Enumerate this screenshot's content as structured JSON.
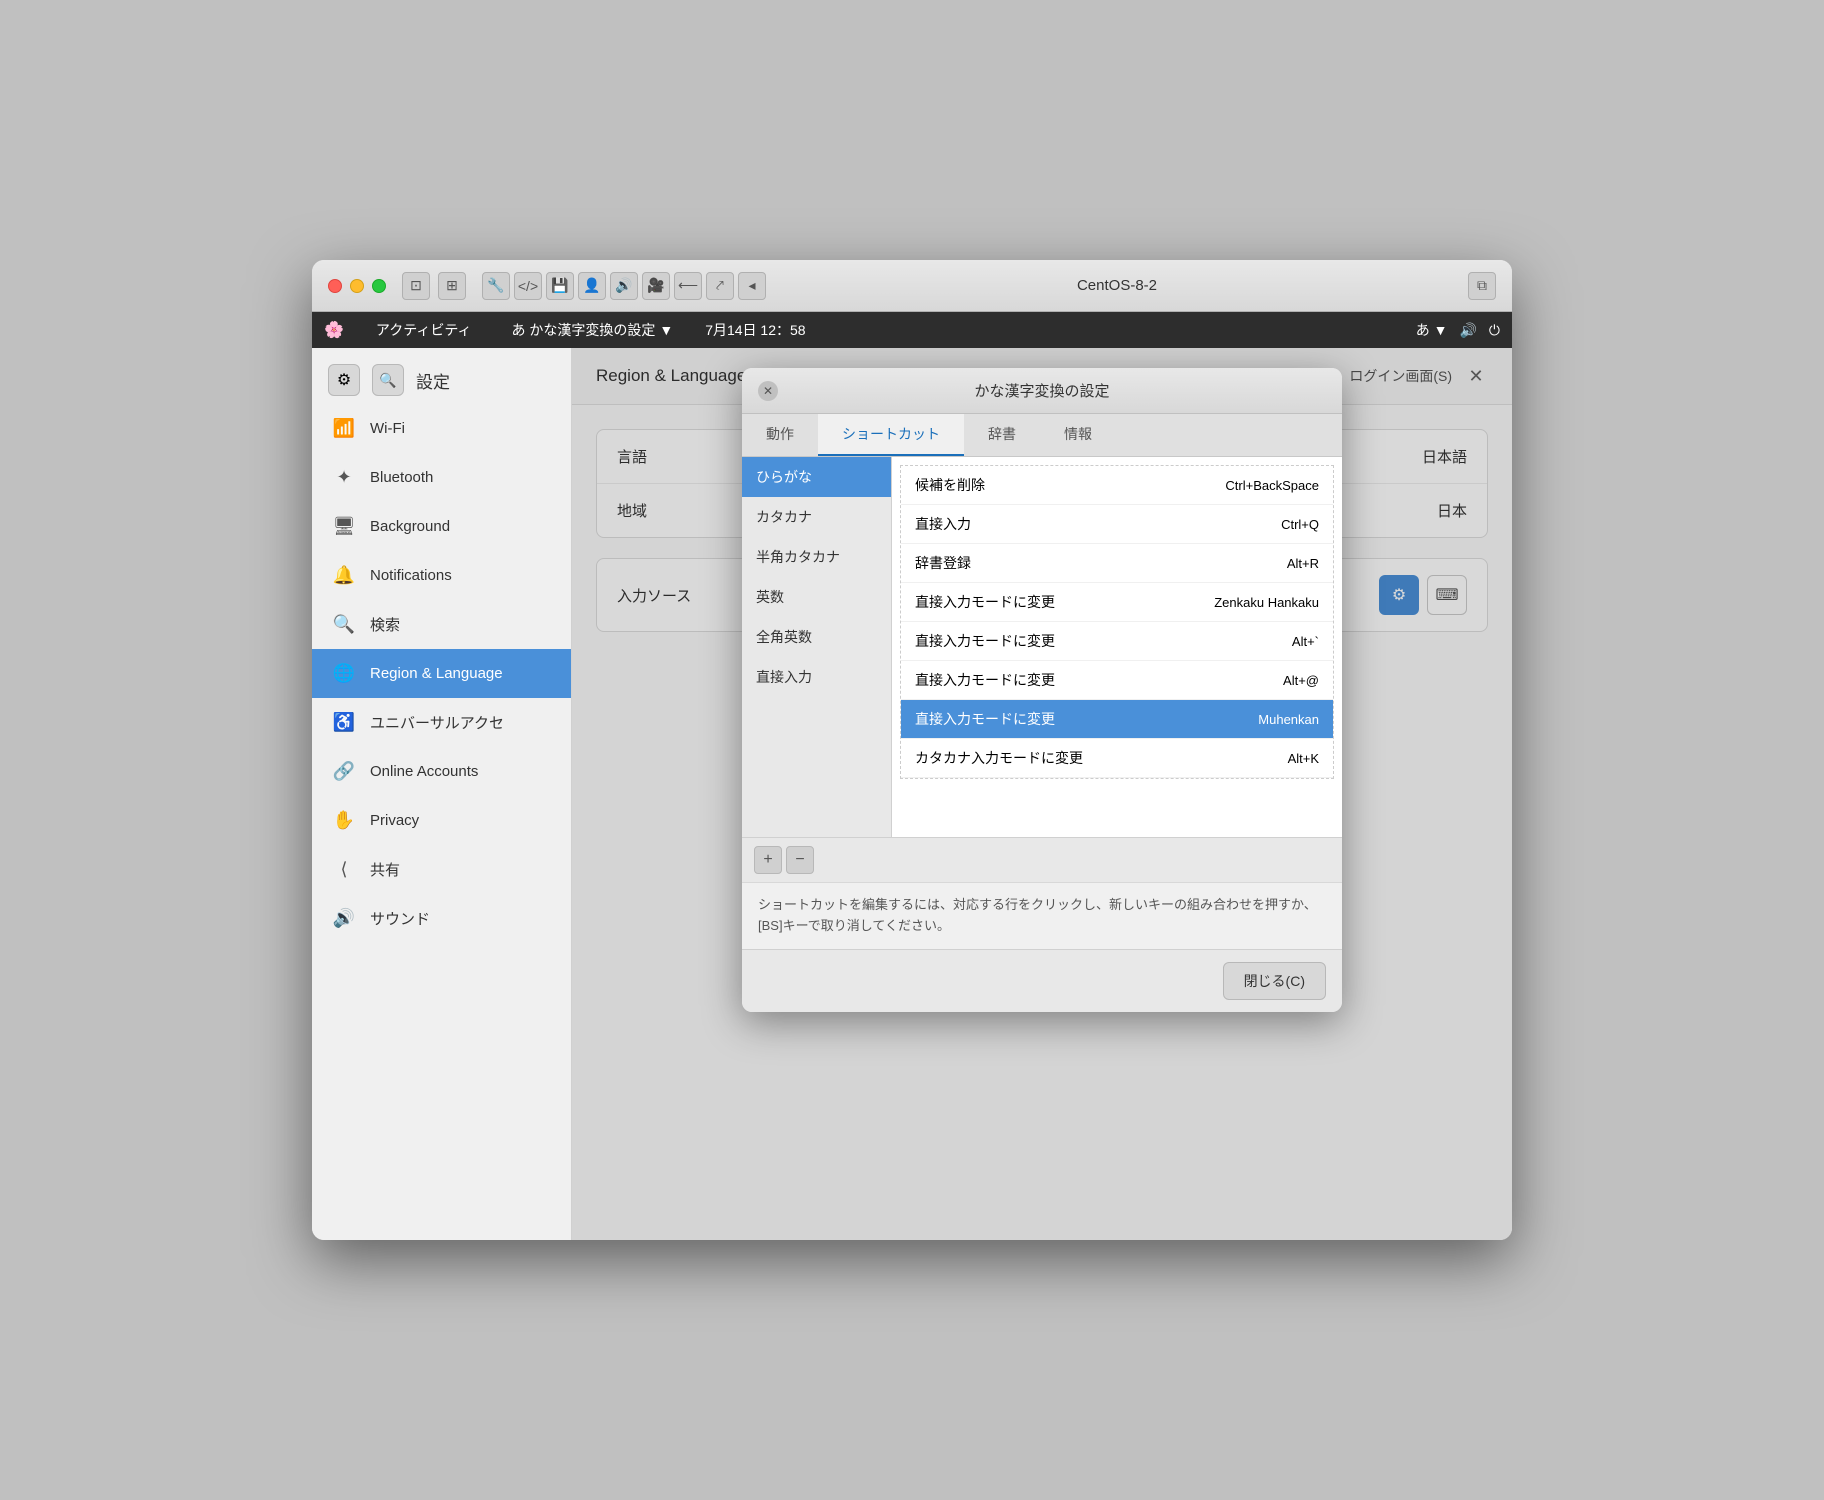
{
  "window": {
    "title": "CentOS-8-2",
    "titlebar_buttons": [
      "⊡",
      "⊞",
      "⟵",
      "⤤",
      "⟵"
    ]
  },
  "menubar": {
    "logo": "🌸",
    "activity_label": "アクティビティ",
    "kana_label": "あ かな漢字変換の設定 ▼",
    "datetime": "7月14日 12：58",
    "ime_status": "あ ▼",
    "sound_icon": "🔊",
    "power_icon": "⏻"
  },
  "settings_header": {
    "gear_icon": "⚙",
    "search_icon": "🔍",
    "title": "設定",
    "logout_label": "ログイン画面(S)",
    "close_icon": "✕"
  },
  "sidebar": {
    "items": [
      {
        "id": "wifi",
        "icon": "📶",
        "label": "Wi-Fi",
        "active": false
      },
      {
        "id": "bluetooth",
        "icon": "✦",
        "label": "Bluetooth",
        "active": false
      },
      {
        "id": "background",
        "icon": "🖥",
        "label": "Background",
        "active": false
      },
      {
        "id": "notifications",
        "icon": "🔔",
        "label": "Notifications",
        "active": false
      },
      {
        "id": "search",
        "icon": "🔍",
        "label": "検索",
        "active": false
      },
      {
        "id": "region",
        "icon": "🌐",
        "label": "Region & Language",
        "active": true
      },
      {
        "id": "universal",
        "icon": "♿",
        "label": "ユニバーサルアクセ",
        "active": false
      },
      {
        "id": "online",
        "icon": "🔗",
        "label": "Online Accounts",
        "active": false
      },
      {
        "id": "privacy",
        "icon": "✋",
        "label": "Privacy",
        "active": false
      },
      {
        "id": "share",
        "icon": "⟨",
        "label": "共有",
        "active": false
      },
      {
        "id": "sound",
        "icon": "🔊",
        "label": "サウンド",
        "active": false
      }
    ]
  },
  "main_panel": {
    "title": "Region & Language",
    "close_icon": "✕",
    "lang_rows": [
      {
        "label": "言語",
        "value": "日本語"
      },
      {
        "label": "地域",
        "value": "日本"
      }
    ],
    "input_sources_label": "入力ソース",
    "gear_btn_icon": "⚙",
    "keyboard_btn_icon": "⌨"
  },
  "dialog": {
    "title": "かな漢字変換の設定",
    "close_icon": "✕",
    "tabs": [
      {
        "id": "behavior",
        "label": "動作",
        "active": false
      },
      {
        "id": "shortcut",
        "label": "ショートカット",
        "active": true
      },
      {
        "id": "dictionary",
        "label": "辞書",
        "active": false
      },
      {
        "id": "info",
        "label": "情報",
        "active": false
      }
    ],
    "left_items": [
      {
        "id": "hiragana",
        "label": "ひらがな",
        "active": true
      },
      {
        "id": "katakana",
        "label": "カタカナ",
        "active": false
      },
      {
        "id": "hankaku",
        "label": "半角カタカナ",
        "active": false
      },
      {
        "id": "eisu",
        "label": "英数",
        "active": false
      },
      {
        "id": "zenkaku_eisu",
        "label": "全角英数",
        "active": false
      },
      {
        "id": "direct",
        "label": "直接入力",
        "active": false
      }
    ],
    "shortcuts": [
      {
        "id": "delete_candidate",
        "label": "候補を削除",
        "key": "Ctrl+BackSpace",
        "active": false
      },
      {
        "id": "direct_input",
        "label": "直接入力",
        "key": "Ctrl+Q",
        "active": false
      },
      {
        "id": "dict_register",
        "label": "辞書登録",
        "key": "Alt+R",
        "active": false
      },
      {
        "id": "change_direct1",
        "label": "直接入力モードに変更",
        "key": "Zenkaku Hankaku",
        "active": false
      },
      {
        "id": "change_direct2",
        "label": "直接入力モードに変更",
        "key": "Alt+`",
        "active": false
      },
      {
        "id": "change_direct3",
        "label": "直接入力モードに変更",
        "key": "Alt+@",
        "active": false
      },
      {
        "id": "change_direct4",
        "label": "直接入力モードに変更",
        "key": "Muhenkan",
        "active": true
      },
      {
        "id": "change_katakana",
        "label": "カタカナ入力モードに変更",
        "key": "Alt+K",
        "active": false
      }
    ],
    "add_btn": "+",
    "remove_btn": "−",
    "help_text": "ショートカットを編集するには、対応する行をクリックし、新しいキーの組み合わせを押すか、[BS]キーで取り消してください。",
    "close_btn_label": "閉じる(C)"
  }
}
